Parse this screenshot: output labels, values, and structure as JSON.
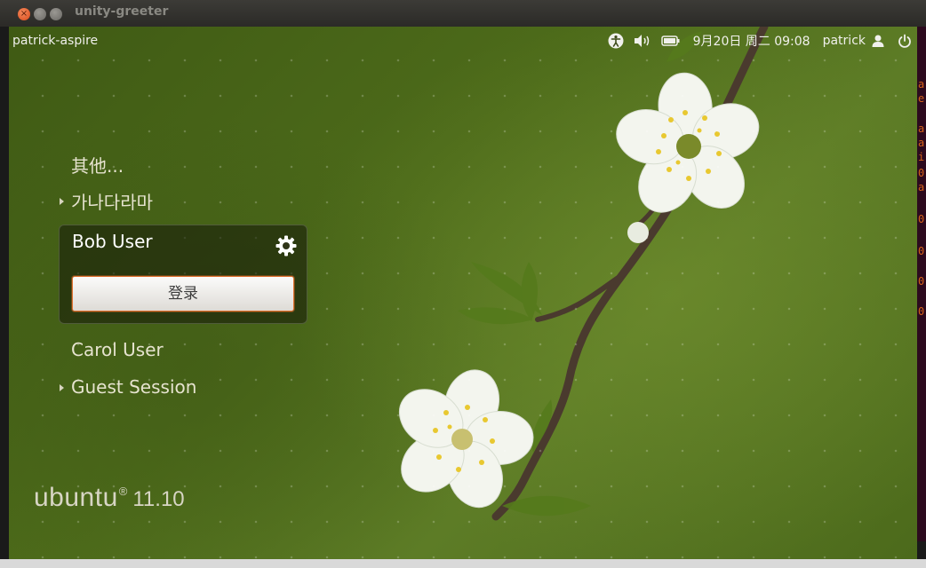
{
  "window": {
    "title": "unity-greeter"
  },
  "panel": {
    "hostname": "patrick-aspire",
    "clock": "9月20日 周二 09:08",
    "user": "patrick"
  },
  "users": {
    "other": "其他...",
    "korean": "가나다라마",
    "selected": "Bob User",
    "carol": "Carol User",
    "guest": "Guest Session"
  },
  "login": {
    "button_label": "登录"
  },
  "brand": {
    "word": "ubuntu",
    "version": "11.10"
  },
  "icons": {
    "accessibility": "accessibility-icon",
    "volume": "volume-icon",
    "battery": "battery-icon",
    "user": "user-icon",
    "power": "power-icon",
    "session": "gear-icon"
  },
  "colors": {
    "background": "#4d6b1a",
    "accent": "#e0702e",
    "panel_text": "#f0f0ec"
  }
}
